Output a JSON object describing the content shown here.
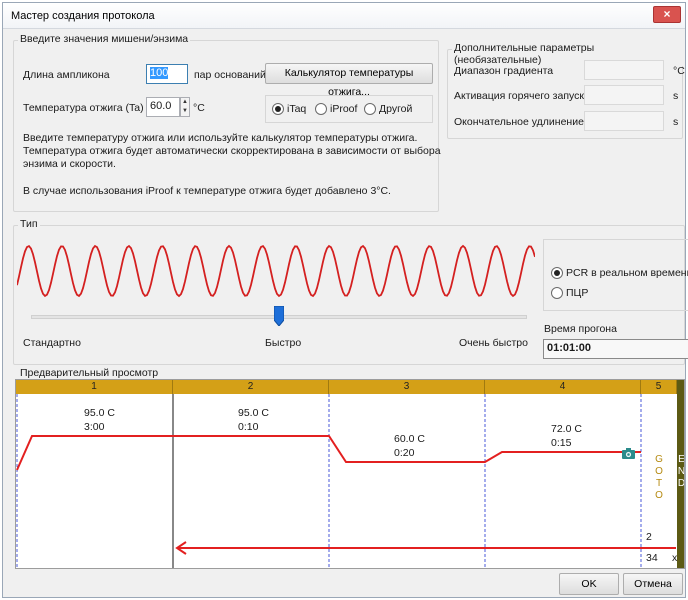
{
  "window": {
    "title": "Мастер создания протокола",
    "close_glyph": "×"
  },
  "target": {
    "group_title": "Введите значения мишени/энзима",
    "amplicon_label": "Длина ампликона",
    "amplicon_value": "100",
    "amplicon_unit": "пар оснований",
    "calc_button": "Калькулятор температуры отжига...",
    "anneal_label": "Температура отжига (Ta)",
    "anneal_value": "60.0",
    "anneal_unit": "°C",
    "enzymes": [
      {
        "label": "iTaq",
        "selected": true
      },
      {
        "label": "iProof",
        "selected": false
      },
      {
        "label": "Другой",
        "selected": false
      }
    ],
    "help_text_1": "Введите температуру отжига или используйте калькулятор температуры отжига.",
    "help_text_2": "Температура отжига будет автоматически скорректирована в зависимости от выбора",
    "help_text_3": "энзима и скорости.",
    "help_text_4": "В случае использования iProof к температуре отжига будет добавлено 3°C."
  },
  "extra": {
    "group_title": "Дополнительные параметры (необязательные)",
    "rows": [
      {
        "label": "Диапазон градиента",
        "value": "",
        "unit": "°C"
      },
      {
        "label": "Активация горячего запуска",
        "value": "",
        "unit": "s"
      },
      {
        "label": "Окончательное удлинение",
        "value": "",
        "unit": "s"
      }
    ]
  },
  "type": {
    "group_title": "Тип",
    "wave_color": "#d42020",
    "speed_labels": {
      "slow": "Стандартно",
      "mid": "Быстро",
      "fast": "Очень быстро"
    },
    "slider_level": 0.5,
    "modes": [
      {
        "label": "PCR в реальном времени",
        "selected": true
      },
      {
        "label": "ПЦР",
        "selected": false
      }
    ],
    "runtime_label": "Время прогона",
    "runtime_value": "01:01:00"
  },
  "preview": {
    "group_title": "Предварительный просмотр",
    "header_color": "#d4a017",
    "line_color": "#e32020",
    "steps": [
      {
        "num": "1",
        "temp": "95.0  C",
        "time": "3:00"
      },
      {
        "num": "2",
        "temp": "95.0  C",
        "time": "0:10"
      },
      {
        "num": "3",
        "temp": "60.0  C",
        "time": "0:20"
      },
      {
        "num": "4",
        "temp": "72.0  C",
        "time": "0:15"
      },
      {
        "num": "5"
      }
    ],
    "goto_letters": [
      "G",
      "O",
      "T",
      "O"
    ],
    "goto_target": "2",
    "goto_repeat": "34",
    "goto_x": "x",
    "end_letters": [
      "E",
      "N",
      "D"
    ],
    "camera_icon": "camera-icon"
  },
  "footer": {
    "ok": "OK",
    "cancel": "Отмена"
  }
}
